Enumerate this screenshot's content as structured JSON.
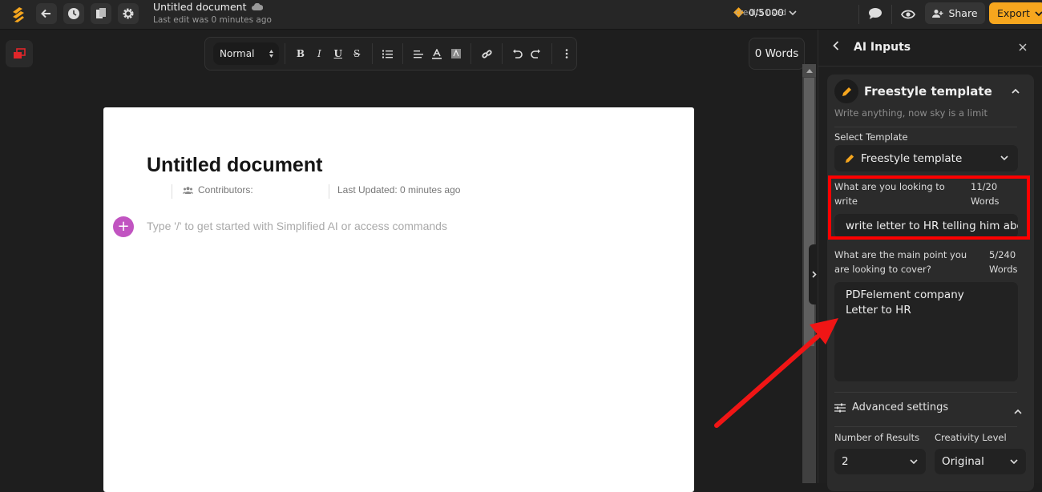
{
  "header": {
    "doc_title": "Untitled document",
    "last_edit": "Last edit was 0 minutes ago",
    "credits_value": "0/5000",
    "credits_label": "credits used",
    "share_label": "Share",
    "export_label": "Export"
  },
  "toolbar": {
    "format_value": "Normal",
    "bold": "B",
    "italic": "I",
    "underline": "U",
    "strike": "S"
  },
  "word_count": "0 Words",
  "document": {
    "title": "Untitled document",
    "contributors_label": "Contributors:",
    "last_updated": "Last Updated: 0 minutes ago",
    "placeholder": "Type '/' to get started with Simplified AI or access commands"
  },
  "panel": {
    "title": "AI Inputs",
    "template_title": "Freestyle template",
    "template_subtitle": "Write anything, now sky is a limit",
    "select_template_label": "Select Template",
    "select_template_value": "Freestyle template",
    "field1": {
      "label": "What are you looking to write",
      "count": "11/20 Words",
      "value": "write letter to HR telling him abou"
    },
    "field2": {
      "label": "What are the main point you are looking to cover?",
      "count": "5/240 Words",
      "lines": [
        "PDFelement company",
        "Letter to HR"
      ]
    },
    "advanced_label": "Advanced settings",
    "results_label": "Number of Results",
    "results_value": "2",
    "creativity_label": "Creativity Level",
    "creativity_value": "Original"
  },
  "colors": {
    "accent": "#f6a61e",
    "annotation": "#ff0000",
    "add_button": "#c154c1"
  }
}
